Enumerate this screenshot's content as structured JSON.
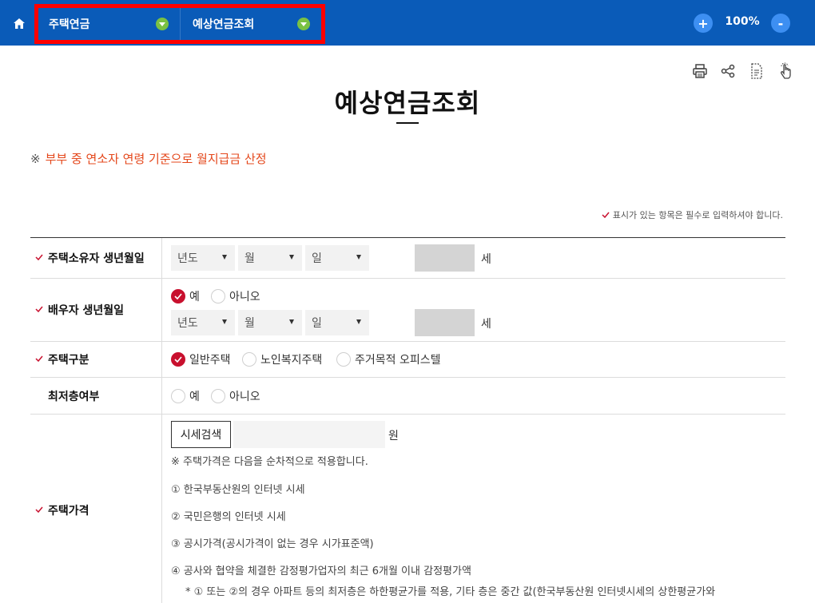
{
  "topbar": {
    "home_icon": "home-icon",
    "crumbs": [
      "주택연금",
      "예상연금조회"
    ],
    "zoom_in": "+",
    "zoom_value": "100%",
    "zoom_out": "-"
  },
  "utils": [
    "print-icon",
    "share-icon",
    "document-icon",
    "touch-icon"
  ],
  "page": {
    "title": "예상연금조회",
    "notice_mark": "※",
    "notice": "부부 중 연소자 연령 기준으로 월지급금 산정",
    "required_note": "표시가 있는 항목은 필수로 입력하셔야 합니다."
  },
  "form": {
    "owner_birth": {
      "label": "주택소유자 생년월일",
      "year": "년도",
      "month": "월",
      "day": "일",
      "age_unit": "세"
    },
    "spouse_birth": {
      "label": "배우자 생년월일",
      "yes": "예",
      "no": "아니오",
      "year": "년도",
      "month": "월",
      "day": "일",
      "age_unit": "세"
    },
    "house_type": {
      "label": "주택구분",
      "options": [
        "일반주택",
        "노인복지주택",
        "주거목적 오피스텔"
      ]
    },
    "lowest_floor": {
      "label": "최저층여부",
      "yes": "예",
      "no": "아니오"
    },
    "house_price": {
      "label": "주택가격",
      "search_button": "시세검색",
      "unit": "원",
      "note": "※ 주택가격은 다음을 순차적으로 적용합니다.",
      "items": [
        "① 한국부동산원의 인터넷 시세",
        "② 국민은행의 인터넷 시세",
        "③ 공시가격(공시가격이 없는 경우 시가표준액)",
        "④ 공사와 협약을 체결한 감정평가업자의 최근 6개월 이내 감정평가액"
      ],
      "footnote": "* ① 또는 ②의 경우 아파트 등의 최저층은 하한평균가를 적용, 기타 층은 중간 값(한국부동산원 인터넷시세의 상한평균가와"
    }
  },
  "colors": {
    "topbar": "#0a5bb8",
    "highlight": "#ff0000",
    "accent_red": "#c8102e",
    "notice": "#e4471b"
  }
}
